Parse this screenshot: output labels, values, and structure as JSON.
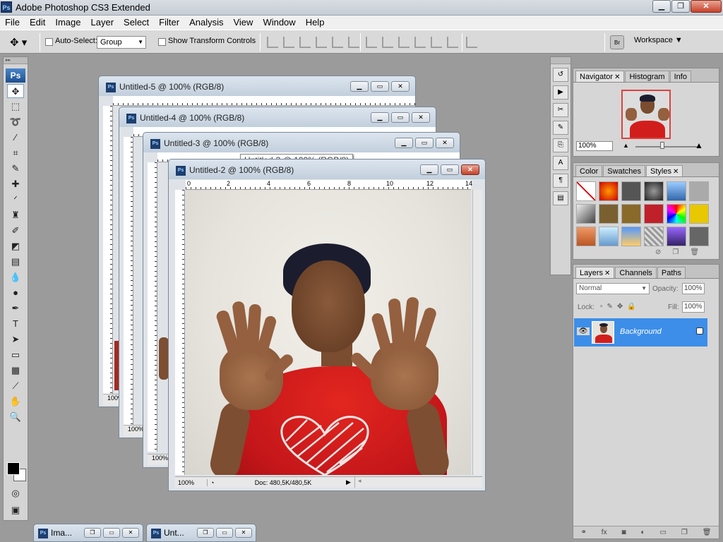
{
  "app": {
    "title": "Adobe Photoshop CS3 Extended",
    "logo": "Ps"
  },
  "menu": [
    "File",
    "Edit",
    "Image",
    "Layer",
    "Select",
    "Filter",
    "Analysis",
    "View",
    "Window",
    "Help"
  ],
  "options": {
    "auto_select_label": "Auto-Select:",
    "auto_select_value": "Group",
    "show_transform_label": "Show Transform Controls",
    "workspace_label": "Workspace",
    "bridge_label": "Br"
  },
  "tools": {
    "logo": "Ps",
    "items": [
      "move-tool",
      "marquee-tool",
      "lasso-tool",
      "magic-wand-tool",
      "crop-tool",
      "slice-tool",
      "healing-brush-tool",
      "brush-tool",
      "clone-stamp-tool",
      "history-brush-tool",
      "eraser-tool",
      "gradient-tool",
      "blur-tool",
      "dodge-tool",
      "pen-tool",
      "type-tool",
      "path-selection-tool",
      "shape-tool",
      "notes-tool",
      "eyedropper-tool",
      "hand-tool",
      "zoom-tool"
    ]
  },
  "documents": [
    {
      "title": "Untitled-5 @ 100% (RGB/8)"
    },
    {
      "title": "Untitled-4 @ 100% (RGB/8)"
    },
    {
      "title": "Untitled-3 @ 100% (RGB/8)"
    },
    {
      "title": "Untitled-2 @ 100% (RGB/8)",
      "zoom": "100%",
      "doc_info": "Doc: 480,5K/480,5K"
    }
  ],
  "ruler_numbers": [
    "0",
    "2",
    "4",
    "6",
    "8",
    "10",
    "12",
    "14"
  ],
  "side_zoom": [
    "100%",
    "100%",
    "100%"
  ],
  "tooltip": "Untitled-3 @ 100% (RGB/8)",
  "navigator": {
    "tabs": [
      "Navigator",
      "Histogram",
      "Info"
    ],
    "zoom": "100%"
  },
  "styles_panel": {
    "tabs": [
      "Color",
      "Swatches",
      "Styles"
    ]
  },
  "layers_panel": {
    "tabs": [
      "Layers",
      "Channels",
      "Paths"
    ],
    "blend_mode": "Normal",
    "opacity_label": "Opacity:",
    "opacity": "100%",
    "lock_label": "Lock:",
    "fill_label": "Fill:",
    "fill": "100%",
    "layer_name": "Background"
  },
  "minimized": [
    {
      "title": "Ima..."
    },
    {
      "title": "Unt..."
    }
  ],
  "colors": {
    "accent": "#3d8ee8",
    "shirt": "#d11e1c",
    "workspace_bg": "#9b9b9b"
  }
}
